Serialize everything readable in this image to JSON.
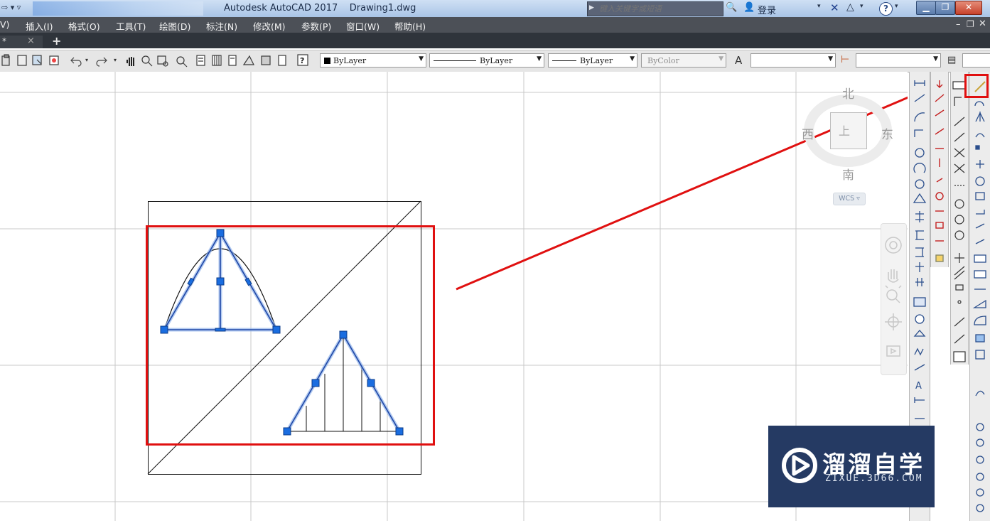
{
  "window": {
    "title": "Autodesk AutoCAD 2017    Drawing1.dwg",
    "search_placeholder": "键入关键字或短语",
    "login": "登录",
    "help": "?"
  },
  "menu": {
    "items": [
      "V)",
      "插入(I)",
      "格式(O)",
      "工具(T)",
      "绘图(D)",
      "标注(N)",
      "修改(M)",
      "参数(P)",
      "窗口(W)",
      "帮助(H)"
    ]
  },
  "document": {
    "tab_suffix": "*",
    "close_glyph": "×",
    "new_tab_glyph": "+"
  },
  "properties": {
    "color": "ByLayer",
    "linetype": "ByLayer",
    "lineweight": "ByLayer",
    "plotstyle": "ByColor"
  },
  "viewcube": {
    "north": "北",
    "south": "南",
    "east": "东",
    "west": "西",
    "top_glyph": "上",
    "coord_system": "WCS"
  },
  "watermark": {
    "title": "溜溜自学",
    "url": "ZIXUE.3D66.COM"
  },
  "colors": {
    "annotation_red": "#e01010",
    "grip_blue": "#1a6de0",
    "selected_line": "#2f63c9"
  },
  "icons": [
    "undo-icon",
    "redo-icon",
    "pan-icon",
    "zoom-icon",
    "help-icon",
    "north-icon",
    "play-icon",
    "search-icon",
    "user-icon"
  ]
}
